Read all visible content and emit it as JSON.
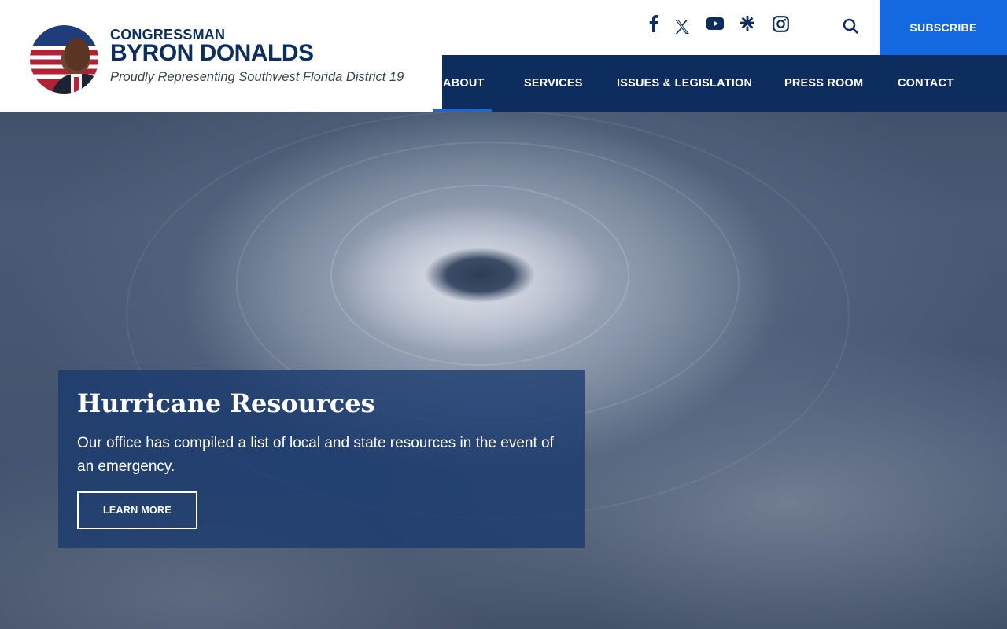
{
  "header": {
    "prefix": "CONGRESSMAN",
    "name": "BYRON DONALDS",
    "tagline": "Proudly Representing Southwest Florida District 19"
  },
  "social_icons": [
    "facebook-icon",
    "x-twitter-icon",
    "youtube-icon",
    "linktree-icon",
    "instagram-icon"
  ],
  "subscribe_label": "SUBSCRIBE",
  "nav": {
    "items": [
      {
        "label": "ABOUT"
      },
      {
        "label": "SERVICES"
      },
      {
        "label": "ISSUES & LEGISLATION"
      },
      {
        "label": "PRESS ROOM"
      },
      {
        "label": "CONTACT"
      }
    ],
    "active": "ABOUT"
  },
  "feature": {
    "title": "Hurricane Resources",
    "text": "Our office has compiled a list of local and state resources in the event of an emergency.",
    "button": "LEARN MORE"
  },
  "colors": {
    "navy": "#0c2d5e",
    "accent_blue": "#1469e1",
    "card_overlay": "#183a6e"
  }
}
